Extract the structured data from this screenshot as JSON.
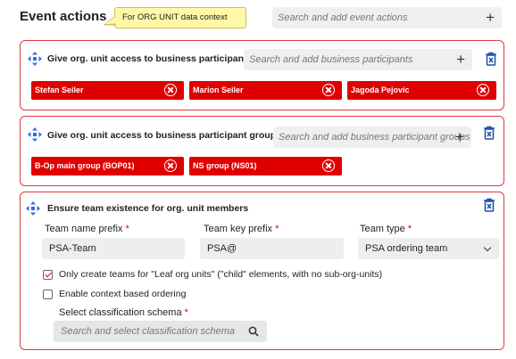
{
  "page": {
    "title": "Event actions",
    "callout": "For ORG UNIT data context",
    "search_placeholder": "Search and add event actions",
    "plus": "+"
  },
  "card1": {
    "title": "Give org. unit access to business participants",
    "search_placeholder": "Search and add business participants",
    "plus": "+",
    "chips": [
      "Stefan Seiler",
      "Marion Seiler",
      "Jagoda Pejovic"
    ]
  },
  "card2": {
    "title": "Give org. unit access to business participant groups",
    "search_placeholder": "Search and add business participant groups",
    "plus": "+",
    "chips": [
      "B-Op main group (BOP01)",
      "NS group (NS01)"
    ]
  },
  "card3": {
    "title": "Ensure team existence for org. unit members",
    "fields": {
      "prefix_label": "Team name prefix",
      "prefix_value": "PSA-Team",
      "key_label": "Team key prefix",
      "key_value": "PSA@",
      "type_label": "Team type",
      "type_value": "PSA ordering team",
      "required_mark": "*"
    },
    "checkbox_leaf": {
      "label": "Only create teams for \"Leaf org units\" (\"child\" elements, with no sub-org-units)",
      "checked": true
    },
    "checkbox_context": {
      "label": "Enable context based ordering",
      "checked": false
    },
    "schema_label": "Select classification schema",
    "schema_placeholder": "Search and select classification schema"
  },
  "colors": {
    "accent_red": "#e00000",
    "card_border": "#e0383e",
    "move_icon_blue": "#2f6fdc"
  },
  "icons": [
    "move-icon",
    "trash-icon",
    "plus-icon",
    "remove-icon",
    "chevron-down-icon",
    "search-icon",
    "checkbox-icon"
  ]
}
